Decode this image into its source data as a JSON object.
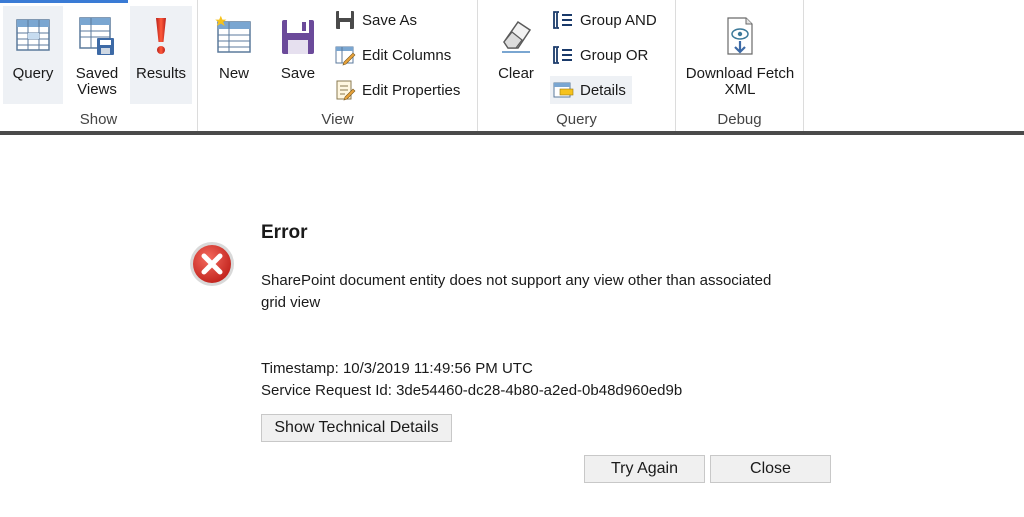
{
  "ribbon": {
    "groups": {
      "show": "Show",
      "view": "View",
      "query": "Query",
      "debug": "Debug"
    },
    "buttons": {
      "query": "Query",
      "saved_views_l1": "Saved",
      "saved_views_l2": "Views",
      "results": "Results",
      "new": "New",
      "save": "Save",
      "save_as": "Save As",
      "edit_columns": "Edit Columns",
      "edit_properties": "Edit Properties",
      "clear": "Clear",
      "group_and": "Group AND",
      "group_or": "Group OR",
      "details": "Details",
      "download_fetch_l1": "Download Fetch",
      "download_fetch_l2": "XML"
    }
  },
  "error": {
    "title": "Error",
    "message": "SharePoint document entity does not support any view other than associated grid view",
    "timestamp": "Timestamp: 10/3/2019 11:49:56 PM UTC",
    "request_id": "Service Request Id: 3de54460-dc28-4b80-a2ed-0b48d960ed9b",
    "show_details_label": "Show Technical Details",
    "try_again_label": "Try Again",
    "close_label": "Close"
  },
  "colors": {
    "accent": "#3a7bd5",
    "error_red": "#d9302c",
    "ribbon_border": "#4a4a4a"
  }
}
